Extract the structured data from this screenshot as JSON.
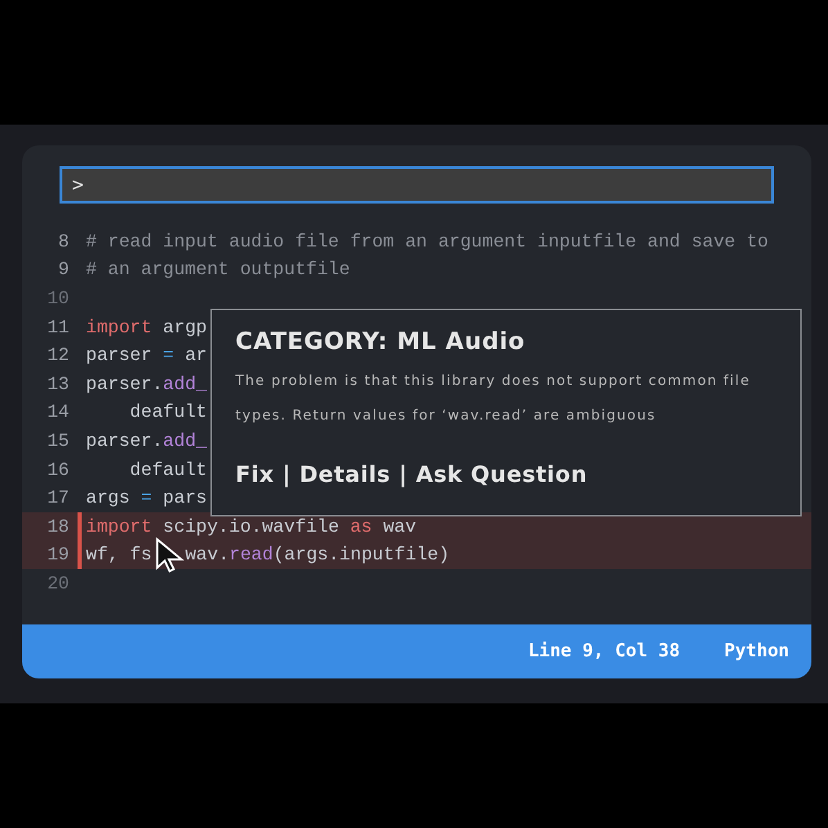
{
  "command_field": {
    "value": ">"
  },
  "code_lines": [
    {
      "number": "8",
      "error": false,
      "tokens": [
        {
          "kind": "comment",
          "text": "# read input audio file from an argument inputfile and save to"
        }
      ]
    },
    {
      "number": "9",
      "error": false,
      "tokens": [
        {
          "kind": "comment",
          "text": "# an argument outputfile"
        }
      ]
    },
    {
      "number": "10",
      "error": false
    },
    {
      "number": "11",
      "error": false,
      "tokens": [
        {
          "kind": "keyword",
          "text": "import"
        },
        {
          "kind": "plain",
          "text": " argp"
        }
      ]
    },
    {
      "number": "12",
      "error": false,
      "tokens": [
        {
          "kind": "plain",
          "text": "parser "
        },
        {
          "kind": "operator",
          "text": "="
        },
        {
          "kind": "plain",
          "text": " ar"
        }
      ]
    },
    {
      "number": "13",
      "error": false,
      "tokens": [
        {
          "kind": "plain",
          "text": "parser."
        },
        {
          "kind": "function",
          "text": "add_"
        }
      ]
    },
    {
      "number": "14",
      "error": false,
      "tokens": [
        {
          "kind": "plain",
          "text": "    deafult"
        }
      ]
    },
    {
      "number": "15",
      "error": false,
      "tokens": [
        {
          "kind": "plain",
          "text": "parser."
        },
        {
          "kind": "function",
          "text": "add_"
        }
      ]
    },
    {
      "number": "16",
      "error": false,
      "tokens": [
        {
          "kind": "plain",
          "text": "    default"
        }
      ]
    },
    {
      "number": "17",
      "error": false,
      "tokens": [
        {
          "kind": "plain",
          "text": "args "
        },
        {
          "kind": "operator",
          "text": "="
        },
        {
          "kind": "plain",
          "text": " pars"
        }
      ]
    },
    {
      "number": "18",
      "error": true,
      "tokens": [
        {
          "kind": "keyword",
          "text": "import"
        },
        {
          "kind": "plain",
          "text": " scipy.io.wavfile "
        },
        {
          "kind": "keyword",
          "text": "as"
        },
        {
          "kind": "plain",
          "text": " wav"
        }
      ]
    },
    {
      "number": "19",
      "error": true,
      "tokens": [
        {
          "kind": "plain",
          "text": "wf, fs"
        },
        {
          "kind": "gap"
        },
        {
          "kind": "plain",
          "text": "wav."
        },
        {
          "kind": "function",
          "text": "read"
        },
        {
          "kind": "plain",
          "text": "(args.inputfile)"
        }
      ]
    },
    {
      "number": "20",
      "error": false
    }
  ],
  "popup": {
    "title": "CATEGORY: ML Audio",
    "message": "The problem is that this library does not support common file types. Return values for ‘wav.read’ are ambiguous",
    "separator": "|",
    "actions": [
      "Fix",
      "Details",
      "Ask Question"
    ]
  },
  "status_bar": {
    "position": "Line 9, Col 38",
    "language": "Python"
  }
}
